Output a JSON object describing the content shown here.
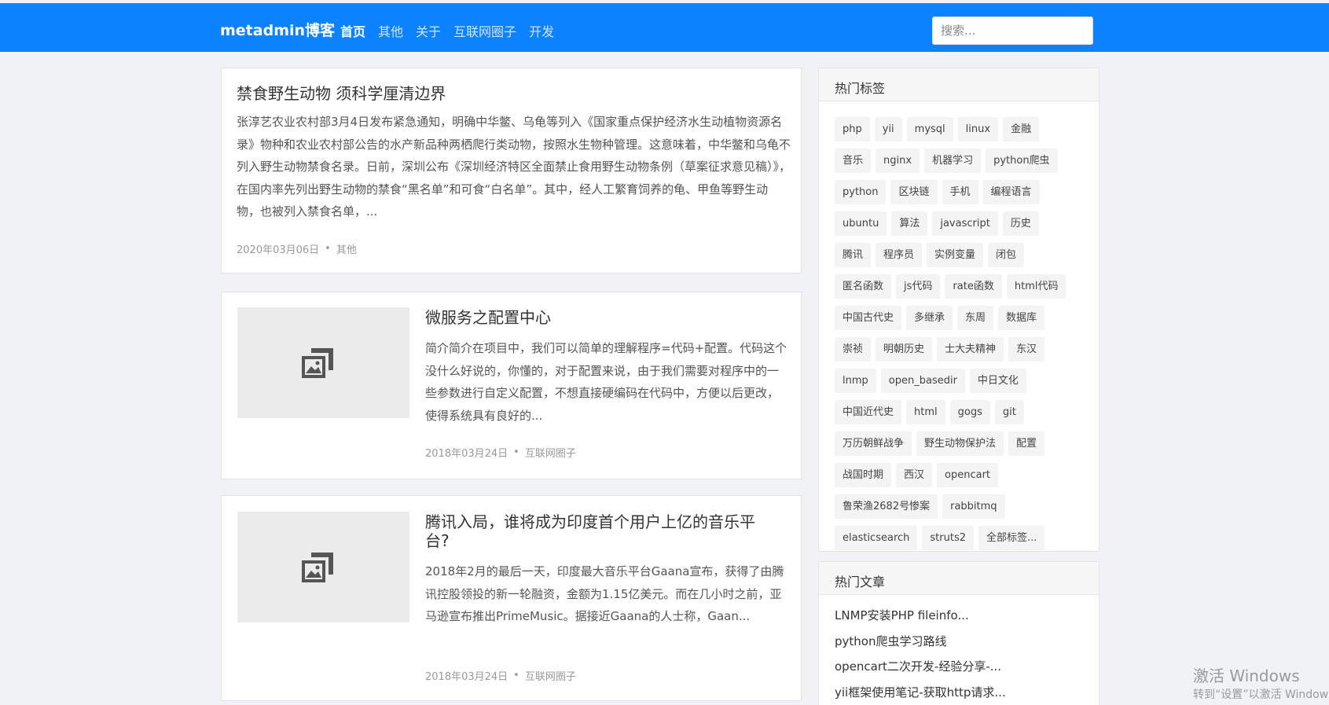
{
  "header": {
    "brand": "metadmin博客",
    "nav": [
      "首页",
      "其他",
      "关于",
      "互联网圈子",
      "开发"
    ],
    "search_placeholder": "搜索..."
  },
  "articles": [
    {
      "title": "禁食野生动物 须科学厘清边界",
      "summary": "张淳艺农业农村部3月4日发布紧急通知，明确中华鳖、乌龟等列入《国家重点保护经济水生动植物资源名录》物种和农业农村部公告的水产新品种两栖爬行类动物，按照水生物种管理。这意味着，中华鳖和乌龟不列入野生动物禁食名录。日前，深圳公布《深圳经济特区全面禁止食用野生动物条例（草案征求意见稿）》，在国内率先列出野生动物的禁食“黑名单”和可食“白名单”。其中，经人工繁育饲养的龟、甲鱼等野生动物，也被列入禁食名单，...",
      "date": "2020年03月06日",
      "category": "其他"
    },
    {
      "title": "微服务之配置中心",
      "summary": "简介简介在项目中，我们可以简单的理解程序=代码+配置。代码这个没什么好说的，你懂的，对于配置来说，由于我们需要对程序中的一些参数进行自定义配置，不想直接硬编码在代码中，方便以后更改，使得系统具有良好的...",
      "date": "2018年03月24日",
      "category": "互联网圈子"
    },
    {
      "title": "腾讯入局，谁将成为印度首个用户上亿的音乐平台?",
      "summary": "2018年2月的最后一天，印度最大音乐平台Gaana宣布，获得了由腾讯控股领投的新一轮融资，金额为1.15亿美元。而在几小时之前，亚马逊宣布推出PrimeMusic。据接近Gaana的人士称，Gaan...",
      "date": "2018年03月24日",
      "category": "互联网圈子"
    }
  ],
  "meta_separator": "•",
  "sidebar": {
    "tags_title": "热门标签",
    "tags": [
      "php",
      "yii",
      "mysql",
      "linux",
      "金融",
      "音乐",
      "nginx",
      "机器学习",
      "python爬虫",
      "python",
      "区块链",
      "手机",
      "编程语言",
      "ubuntu",
      "算法",
      "javascript",
      "历史",
      "腾讯",
      "程序员",
      "实例变量",
      "闭包",
      "匿名函数",
      "js代码",
      "rate函数",
      "html代码",
      "中国古代史",
      "多继承",
      "东周",
      "数据库",
      "崇祯",
      "明朝历史",
      "士大夫精神",
      "东汉",
      "lnmp",
      "open_basedir",
      "中日文化",
      "中国近代史",
      "html",
      "gogs",
      "git",
      "万历朝鲜战争",
      "野生动物保护法",
      "配置",
      "战国时期",
      "西汉",
      "opencart",
      "鲁荣渔2682号惨案",
      "rabbitmq",
      "elasticsearch",
      "struts2",
      "全部标签..."
    ],
    "posts_title": "热门文章",
    "posts": [
      "LNMP安装PHP fileinfo...",
      "python爬虫学习路线",
      "opencart二次开发-经验分享-...",
      "yii框架使用笔记-获取http请求..."
    ]
  },
  "watermark": {
    "line1": "激活 Windows",
    "line2": "转到“设置”以激活 Windows。"
  },
  "colors": {
    "header_bg": "#0d82ff",
    "page_bg": "#f0f2f5",
    "tag_bg": "#f4f4f4"
  }
}
